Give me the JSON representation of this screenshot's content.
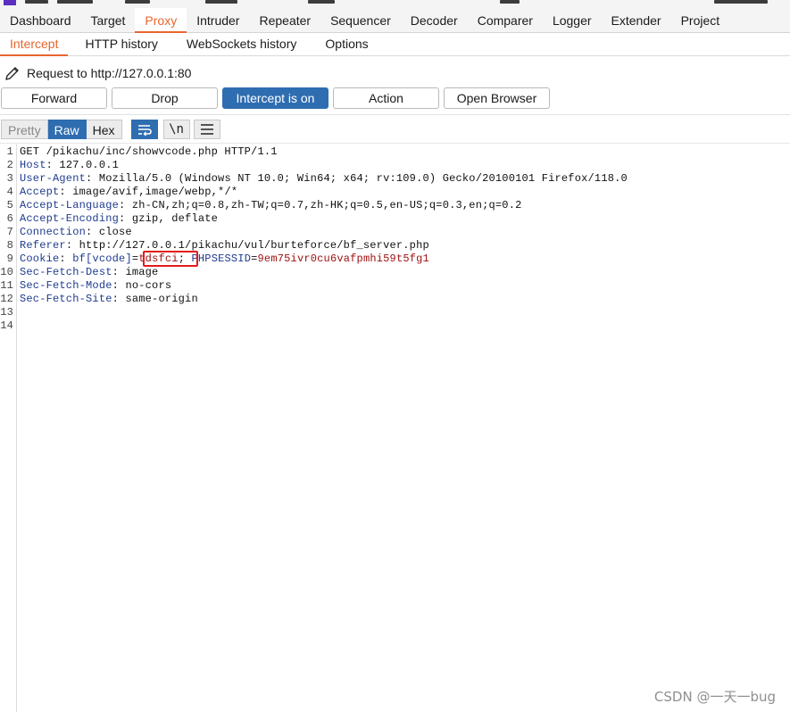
{
  "main_tabs": [
    "Dashboard",
    "Target",
    "Proxy",
    "Intruder",
    "Repeater",
    "Sequencer",
    "Decoder",
    "Comparer",
    "Logger",
    "Extender",
    "Project"
  ],
  "active_main_tab": "Proxy",
  "sub_tabs": [
    "Intercept",
    "HTTP history",
    "WebSockets history",
    "Options"
  ],
  "active_sub_tab": "Intercept",
  "request_line": "Request to http://127.0.0.1:80",
  "buttons": {
    "forward": "Forward",
    "drop": "Drop",
    "intercept": "Intercept is on",
    "action": "Action",
    "open_browser": "Open Browser"
  },
  "view_modes": {
    "pretty": "Pretty",
    "raw": "Raw",
    "hex": "Hex",
    "newline": "\\n"
  },
  "icons": {
    "edit": "pencil-icon",
    "wrap": "wrap-lines-icon",
    "menu": "hamburger-menu-icon"
  },
  "request": [
    {
      "num": "1",
      "name": "",
      "sep": "",
      "value": "GET /pikachu/inc/showvcode.php HTTP/1.1"
    },
    {
      "num": "2",
      "name": "Host",
      "sep": ": ",
      "value": "127.0.0.1"
    },
    {
      "num": "3",
      "name": "User-Agent",
      "sep": ": ",
      "value": "Mozilla/5.0 (Windows NT 10.0; Win64; x64; rv:109.0) Gecko/20100101 Firefox/118.0"
    },
    {
      "num": "4",
      "name": "Accept",
      "sep": ": ",
      "value": "image/avif,image/webp,*/*"
    },
    {
      "num": "5",
      "name": "Accept-Language",
      "sep": ": ",
      "value": "zh-CN,zh;q=0.8,zh-TW;q=0.7,zh-HK;q=0.5,en-US;q=0.3,en;q=0.2"
    },
    {
      "num": "6",
      "name": "Accept-Encoding",
      "sep": ": ",
      "value": "gzip, deflate"
    },
    {
      "num": "7",
      "name": "Connection",
      "sep": ": ",
      "value": "close"
    },
    {
      "num": "8",
      "name": "Referer",
      "sep": ": ",
      "value": "http://127.0.0.1/pikachu/vul/burteforce/bf_server.php"
    },
    {
      "num": "9",
      "name": "Cookie",
      "sep": ": ",
      "value": "",
      "cookie": {
        "name1": "bf[vcode]",
        "eq1": "=",
        "value1": "tdsfci",
        "semi": "; ",
        "name2": "PHPSESSID",
        "eq2": "=",
        "value2": "9em75ivr0cu6vafpmhi59t5fg1"
      }
    },
    {
      "num": "10",
      "name": "Sec-Fetch-Dest",
      "sep": ": ",
      "value": "image"
    },
    {
      "num": "11",
      "name": "Sec-Fetch-Mode",
      "sep": ": ",
      "value": "no-cors"
    },
    {
      "num": "12",
      "name": "Sec-Fetch-Site",
      "sep": ": ",
      "value": "same-origin"
    },
    {
      "num": "13",
      "name": "",
      "sep": "",
      "value": ""
    },
    {
      "num": "14",
      "name": "",
      "sep": "",
      "value": ""
    }
  ],
  "watermark": "CSDN @一天一bug",
  "colors": {
    "accent_orange": "#e8662f",
    "intercept_blue": "#2f6db1",
    "header_name": "#1f3c8f",
    "cookie_value": "#a01111",
    "highlight_box": "#e21b1b"
  }
}
